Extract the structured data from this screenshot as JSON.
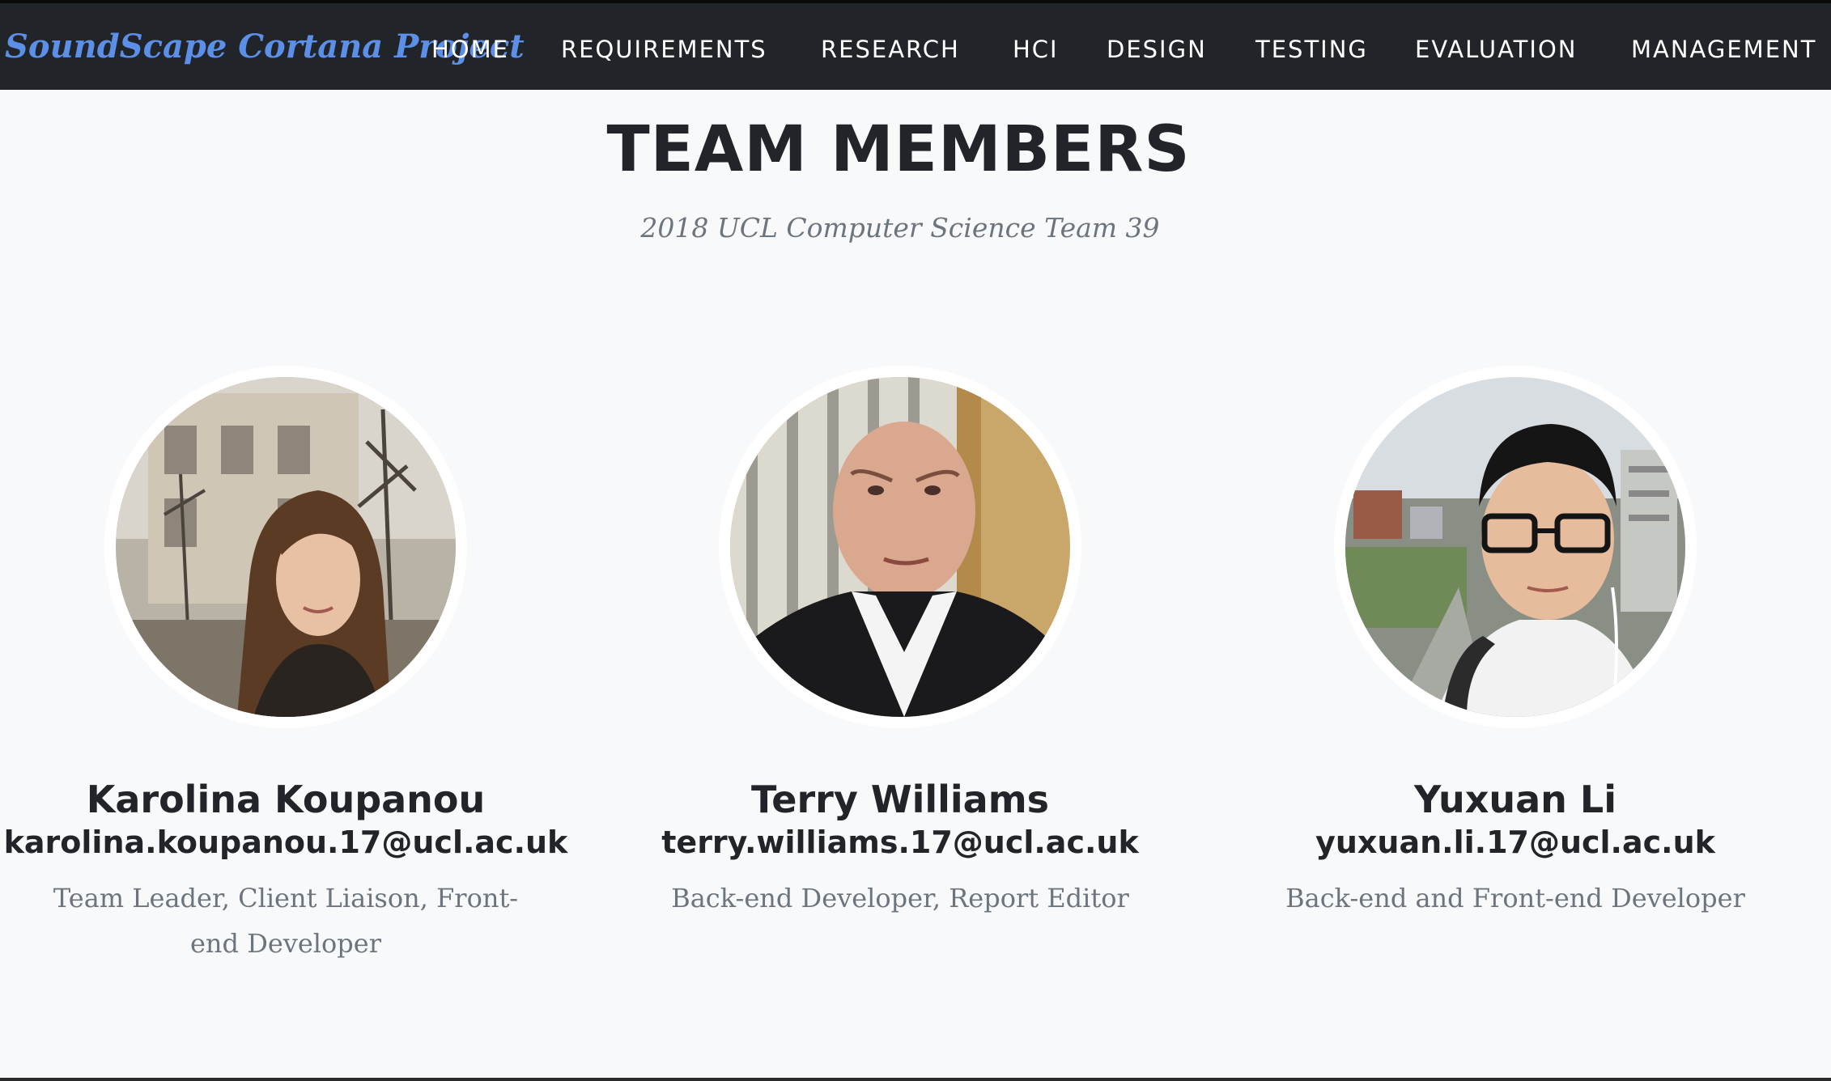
{
  "navbar": {
    "brand": "SoundScape Cortana Project",
    "links": [
      "HOME",
      "REQUIREMENTS",
      "RESEARCH",
      "HCI",
      "DESIGN",
      "TESTING",
      "EVALUATION",
      "MANAGEMENT"
    ]
  },
  "section": {
    "title": "TEAM MEMBERS",
    "subtitle": "2018 UCL Computer Science Team 39"
  },
  "members": [
    {
      "name": "Karolina Koupanou",
      "email": "karolina.koupanou.17@ucl.ac.uk",
      "role": "Team Leader, Client Liaison, Front-end Developer"
    },
    {
      "name": "Terry Williams",
      "email": "terry.williams.17@ucl.ac.uk",
      "role": "Back-end Developer, Report Editor"
    },
    {
      "name": "Yuxuan Li",
      "email": "yuxuan.li.17@ucl.ac.uk",
      "role": "Back-end and Front-end Developer"
    }
  ],
  "colors": {
    "navbar_bg": "#212529",
    "brand": "#5b8fe8",
    "page_bg": "#f8f9fa",
    "muted_text": "#6c757d"
  }
}
